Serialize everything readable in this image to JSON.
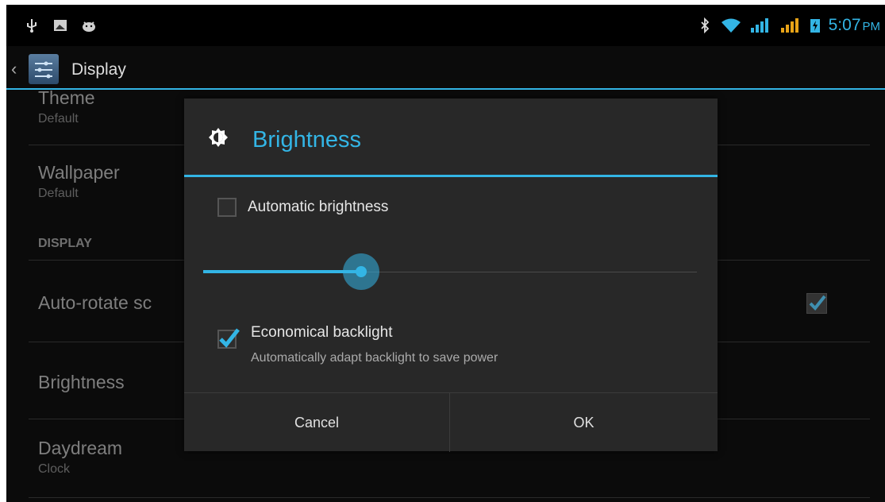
{
  "status_bar": {
    "left_icons": [
      "usb-icon",
      "screenshot-icon",
      "android-debug-icon"
    ],
    "right_icons": [
      "bluetooth-icon",
      "wifi-icon",
      "signal-icon",
      "signal-icon-2",
      "battery-icon"
    ],
    "time": "5:07",
    "ampm": "PM"
  },
  "action_bar": {
    "title": "Display"
  },
  "background_list": {
    "theme": {
      "title": "Theme",
      "summary": "Default"
    },
    "wallpaper": {
      "title": "Wallpaper",
      "summary": "Default"
    },
    "category": "DISPLAY",
    "auto_rotate": {
      "title": "Auto-rotate sc",
      "checked": true
    },
    "brightness": {
      "title": "Brightness"
    },
    "daydream": {
      "title": "Daydream",
      "summary": "Clock"
    }
  },
  "dialog": {
    "title": "Brightness",
    "auto_brightness": {
      "label": "Automatic brightness",
      "checked": false
    },
    "brightness_level": 0.32,
    "economical_backlight": {
      "label": "Economical backlight",
      "summary": "Automatically adapt backlight to save power",
      "checked": true
    },
    "buttons": {
      "cancel": "Cancel",
      "ok": "OK"
    }
  },
  "colors": {
    "accent": "#33b5e5",
    "background": "#0b0b0b",
    "dialog": "#282828"
  }
}
